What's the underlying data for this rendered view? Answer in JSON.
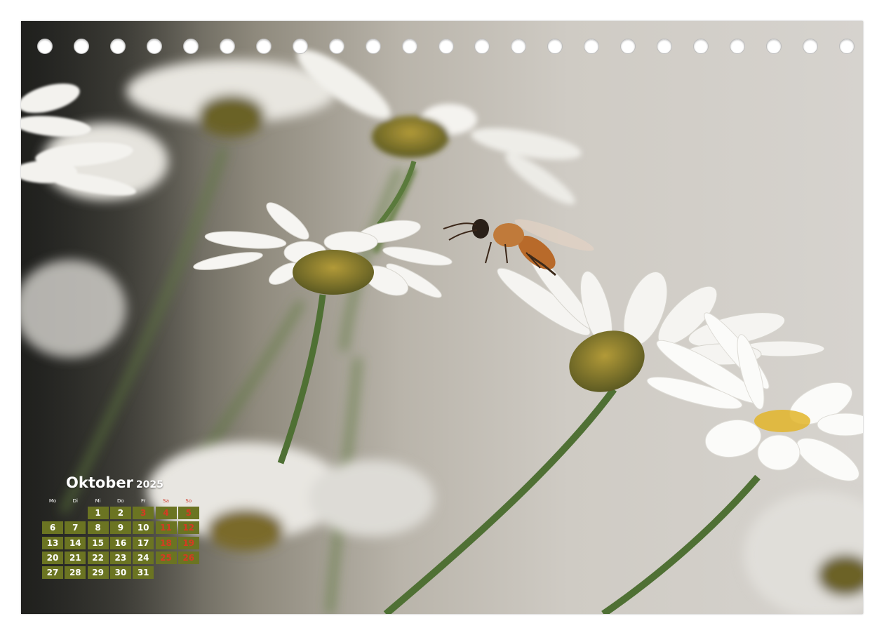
{
  "calendar": {
    "month": "Oktober",
    "year": "2025",
    "weekdays": [
      "Mo",
      "Di",
      "Mi",
      "Do",
      "Fr",
      "Sa",
      "So"
    ],
    "weeks": [
      [
        "",
        "",
        "1",
        "2",
        "3",
        "4",
        "5"
      ],
      [
        "6",
        "7",
        "8",
        "9",
        "10",
        "11",
        "12"
      ],
      [
        "13",
        "14",
        "15",
        "16",
        "17",
        "18",
        "19"
      ],
      [
        "20",
        "21",
        "22",
        "23",
        "24",
        "25",
        "26"
      ],
      [
        "27",
        "28",
        "29",
        "30",
        "31",
        "",
        ""
      ]
    ],
    "holidays": [
      "3"
    ]
  },
  "binding": {
    "hole_count": 23
  },
  "colors": {
    "cell_background": "#6b7422",
    "weekend_text": "#d63a22",
    "weekday_text": "#ffffff"
  },
  "photo": {
    "subject_icons": [
      "daisy-flower-icon",
      "bee-icon"
    ]
  }
}
